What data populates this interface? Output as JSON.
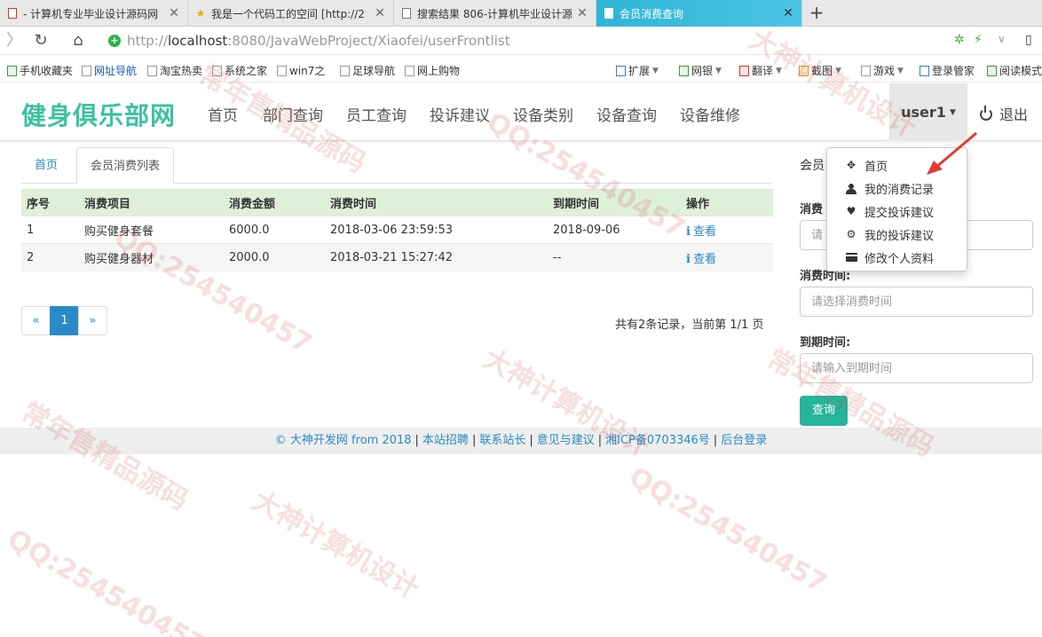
{
  "browser": {
    "tabs": [
      {
        "title": "- 计算机专业毕业设计源码网",
        "icon": "red-page-icon"
      },
      {
        "title": "我是一个代码工的空间 [http://2",
        "icon": "star-icon"
      },
      {
        "title": "搜索结果 806-计算机毕业设计源",
        "icon": "page-icon"
      },
      {
        "title": "会员消费查询",
        "icon": "page-icon"
      }
    ],
    "new_tab": "+",
    "url_host": "http://",
    "url_domain": "localhost",
    "url_path": ":8080/JavaWebProject/Xiaofei/userFrontlist",
    "bookmarks": [
      "手机收藏夹",
      "网址导航",
      "淘宝热卖",
      "系统之家",
      "win7之",
      "足球导航",
      "网上购物",
      "扩展",
      "网银",
      "翻译",
      "截图",
      "游戏",
      "登录管家",
      "阅读模式"
    ]
  },
  "header": {
    "brand": "健身俱乐部网",
    "nav": [
      "首页",
      "部门查询",
      "员工查询",
      "投诉建议",
      "设备类别",
      "设备查询",
      "设备维修"
    ],
    "user": "user1",
    "logout": "退出"
  },
  "content_tabs": {
    "home": "首页",
    "current": "会员消费列表"
  },
  "table": {
    "columns": [
      "序号",
      "消费项目",
      "消费金额",
      "消费时间",
      "到期时间",
      "操作"
    ],
    "rows": [
      {
        "no": "1",
        "item": "购买健身套餐",
        "amount": "6000.0",
        "time": "2018-03-06 23:59:53",
        "expire": "2018-09-06",
        "action": "查看"
      },
      {
        "no": "2",
        "item": "购买健身器材",
        "amount": "2000.0",
        "time": "2018-03-21 15:27:42",
        "expire": "--",
        "action": "查看"
      }
    ]
  },
  "pager": {
    "prev": "«",
    "current": "1",
    "next": "»"
  },
  "record_info": "共有2条记录，当前第 1/1 页",
  "search": {
    "title": "会员",
    "field1_label": "消费",
    "field1_placeholder": "请",
    "field2_label": "消费时间:",
    "field2_placeholder": "请选择消费时间",
    "field3_label": "到期时间:",
    "field3_placeholder": "请输入到期时间",
    "button": "查询"
  },
  "user_menu": [
    {
      "label": "首页",
      "icon": "move-icon"
    },
    {
      "label": "我的消费记录",
      "icon": "user-icon"
    },
    {
      "label": "提交投诉建议",
      "icon": "heart-icon"
    },
    {
      "label": "我的投诉建议",
      "icon": "cog-icon"
    },
    {
      "label": "修改个人资料",
      "icon": "card-icon"
    }
  ],
  "footer": {
    "copyright": "© 大神开发网 from 2018",
    "links": [
      "本站招聘",
      "联系站长",
      "意见与建议",
      "湘ICP备0703346号",
      "后台登录"
    ]
  },
  "colors": {
    "brand": "#3cc2a0",
    "link": "#2a8ac5",
    "table_head": "#dff0d8",
    "button": "#26b59a",
    "active_tab": "#35b3d5"
  },
  "watermark": [
    "常年售精品源码",
    "QQ:254540457",
    "大神计算机设计"
  ]
}
